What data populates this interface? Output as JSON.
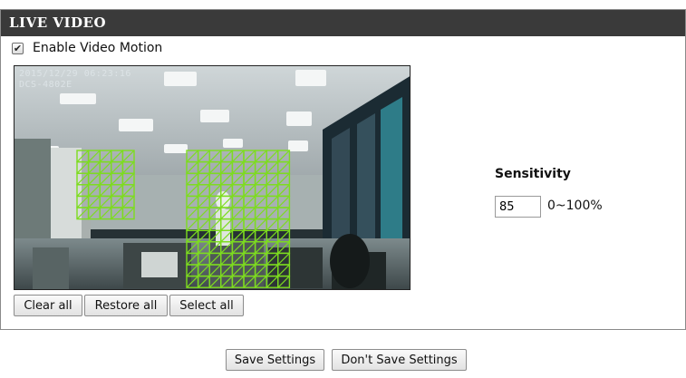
{
  "panel": {
    "title": "LIVE VIDEO"
  },
  "motion": {
    "enable_label": "Enable Video Motion",
    "enabled": true
  },
  "video": {
    "timestamp": "2015/12/29 06:23:16",
    "camera_model": "DCS-4802E",
    "motion_grid_color": "#7ddc1f",
    "active_blocks": "left-cluster and center-cluster"
  },
  "grid_buttons": {
    "clear_all": "Clear all",
    "restore_all": "Restore all",
    "select_all": "Select all"
  },
  "sensitivity": {
    "label": "Sensitivity",
    "value": "85",
    "range": "0~100%"
  },
  "footer": {
    "save": "Save Settings",
    "dont_save": "Don't Save Settings"
  },
  "colors": {
    "header_bg": "#3a3a3a",
    "header_text": "#ffffff"
  }
}
